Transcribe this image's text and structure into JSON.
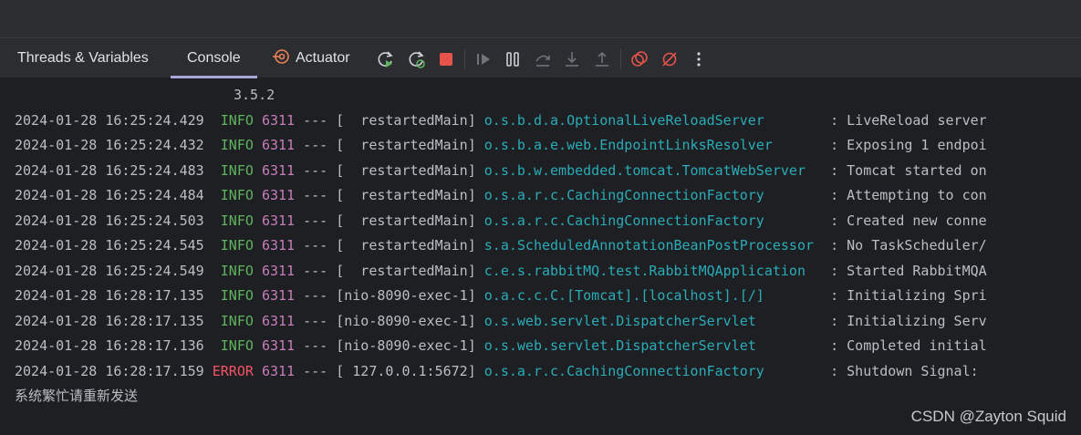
{
  "tabs": [
    {
      "label": "Threads & Variables"
    },
    {
      "label": "Console",
      "active": true
    },
    {
      "label": "Actuator"
    }
  ],
  "toolbar_icons": [
    "rerun-icon",
    "restart-icon",
    "stop-icon",
    "resume-icon",
    "pause-icon",
    "step-over-icon",
    "step-into-icon",
    "step-out-icon",
    "view-breakpoints-icon",
    "mute-breakpoints-icon",
    "more-icon"
  ],
  "console": {
    "version": "3.5.2",
    "lines": [
      {
        "timestamp": "2024-01-28 16:25:24.429",
        "level": "INFO",
        "pid": "6311",
        "sep": "---",
        "thread": "[  restartedMain]",
        "logger": "o.s.b.d.a.OptionalLiveReloadServer       ",
        "message": ": LiveReload server"
      },
      {
        "timestamp": "2024-01-28 16:25:24.432",
        "level": "INFO",
        "pid": "6311",
        "sep": "---",
        "thread": "[  restartedMain]",
        "logger": "o.s.b.a.e.web.EndpointLinksResolver      ",
        "message": ": Exposing 1 endpoi"
      },
      {
        "timestamp": "2024-01-28 16:25:24.483",
        "level": "INFO",
        "pid": "6311",
        "sep": "---",
        "thread": "[  restartedMain]",
        "logger": "o.s.b.w.embedded.tomcat.TomcatWebServer  ",
        "message": ": Tomcat started on"
      },
      {
        "timestamp": "2024-01-28 16:25:24.484",
        "level": "INFO",
        "pid": "6311",
        "sep": "---",
        "thread": "[  restartedMain]",
        "logger": "o.s.a.r.c.CachingConnectionFactory       ",
        "message": ": Attempting to con"
      },
      {
        "timestamp": "2024-01-28 16:25:24.503",
        "level": "INFO",
        "pid": "6311",
        "sep": "---",
        "thread": "[  restartedMain]",
        "logger": "o.s.a.r.c.CachingConnectionFactory       ",
        "message": ": Created new conne"
      },
      {
        "timestamp": "2024-01-28 16:25:24.545",
        "level": "INFO",
        "pid": "6311",
        "sep": "---",
        "thread": "[  restartedMain]",
        "logger": "s.a.ScheduledAnnotationBeanPostProcessor ",
        "message": ": No TaskScheduler/"
      },
      {
        "timestamp": "2024-01-28 16:25:24.549",
        "level": "INFO",
        "pid": "6311",
        "sep": "---",
        "thread": "[  restartedMain]",
        "logger": "c.e.s.rabbitMQ.test.RabbitMQApplication  ",
        "message": ": Started RabbitMQA"
      },
      {
        "timestamp": "2024-01-28 16:28:17.135",
        "level": "INFO",
        "pid": "6311",
        "sep": "---",
        "thread": "[nio-8090-exec-1]",
        "logger": "o.a.c.c.C.[Tomcat].[localhost].[/]       ",
        "message": ": Initializing Spri"
      },
      {
        "timestamp": "2024-01-28 16:28:17.135",
        "level": "INFO",
        "pid": "6311",
        "sep": "---",
        "thread": "[nio-8090-exec-1]",
        "logger": "o.s.web.servlet.DispatcherServlet        ",
        "message": ": Initializing Serv"
      },
      {
        "timestamp": "2024-01-28 16:28:17.136",
        "level": "INFO",
        "pid": "6311",
        "sep": "---",
        "thread": "[nio-8090-exec-1]",
        "logger": "o.s.web.servlet.DispatcherServlet        ",
        "message": ": Completed initial"
      },
      {
        "timestamp": "2024-01-28 16:28:17.159",
        "level": "ERROR",
        "pid": "6311",
        "sep": "---",
        "thread": "[ 127.0.0.1:5672]",
        "logger": "o.s.a.r.c.CachingConnectionFactory       ",
        "message": ": Shutdown Signal: "
      }
    ],
    "output_text": "系统繁忙请重新发送"
  },
  "watermark": "CSDN @Zayton Squid",
  "colors": {
    "info": "#5fb45f",
    "error": "#f75464",
    "pid": "#c77dbb",
    "logger": "#2aacb8",
    "stop": "#e5534b",
    "accent_underline": "#a7a7d9"
  }
}
